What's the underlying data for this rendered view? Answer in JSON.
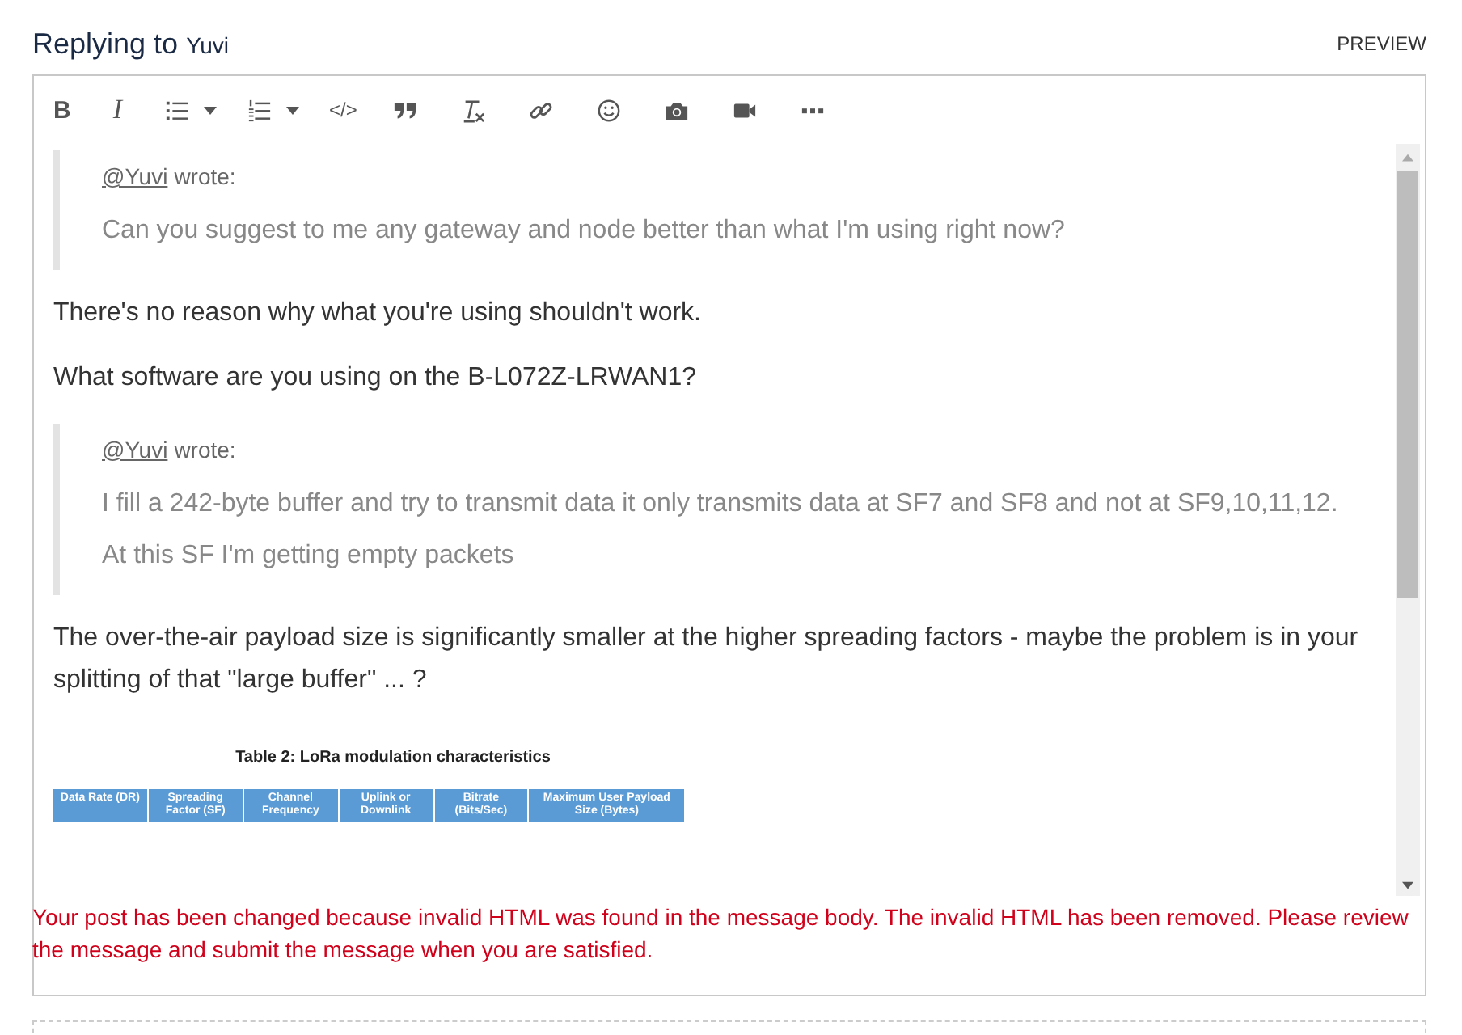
{
  "header": {
    "title": "Replying to",
    "user": "Yuvi",
    "preview": "PREVIEW"
  },
  "toolbar": [
    {
      "kind": "bold",
      "glyph": "B"
    },
    {
      "kind": "italic",
      "glyph": "I"
    },
    {
      "kind": "bullets"
    },
    {
      "kind": "caret"
    },
    {
      "kind": "numbers"
    },
    {
      "kind": "caret"
    },
    {
      "kind": "code",
      "glyph": "</>"
    },
    {
      "kind": "quote"
    },
    {
      "kind": "clear"
    },
    {
      "kind": "link"
    },
    {
      "kind": "emoji"
    },
    {
      "kind": "camera"
    },
    {
      "kind": "video"
    },
    {
      "kind": "more"
    }
  ],
  "content": [
    {
      "kind": "quote",
      "author": "@Yuvi",
      "wrote": "wrote:",
      "lines": [
        "Can you suggest to me any gateway and node better than what I'm using right now?"
      ]
    },
    {
      "kind": "para",
      "text": "There's no reason why what you're using shouldn't work."
    },
    {
      "kind": "para",
      "text": "What software are you using on the B-L072Z-LRWAN1?"
    },
    {
      "kind": "quote",
      "author": "@Yuvi",
      "wrote": "wrote:",
      "lines": [
        "I fill a 242-byte buffer and try to transmit data it only transmits data at SF7 and SF8 and not at SF9,10,11,12.",
        "At this SF I'm getting empty packets"
      ]
    },
    {
      "kind": "para",
      "text": "The over-the-air payload size is significantly smaller at the higher spreading factors - maybe the problem is in your splitting of that \"large buffer\" ... ?"
    },
    {
      "kind": "image",
      "caption": "Table 2: LoRa modulation characteristics",
      "columns": [
        "Data Rate (DR)",
        "Spreading Factor (SF)",
        "Channel Frequency",
        "Uplink or Downlink",
        "Bitrate (Bits/Sec)",
        "Maximum User Payload Size (Bytes)"
      ]
    }
  ],
  "error": "Your post has been changed because invalid HTML was found in the message body. The invalid HTML has been removed. Please review the message and submit the message when you are satisfied."
}
